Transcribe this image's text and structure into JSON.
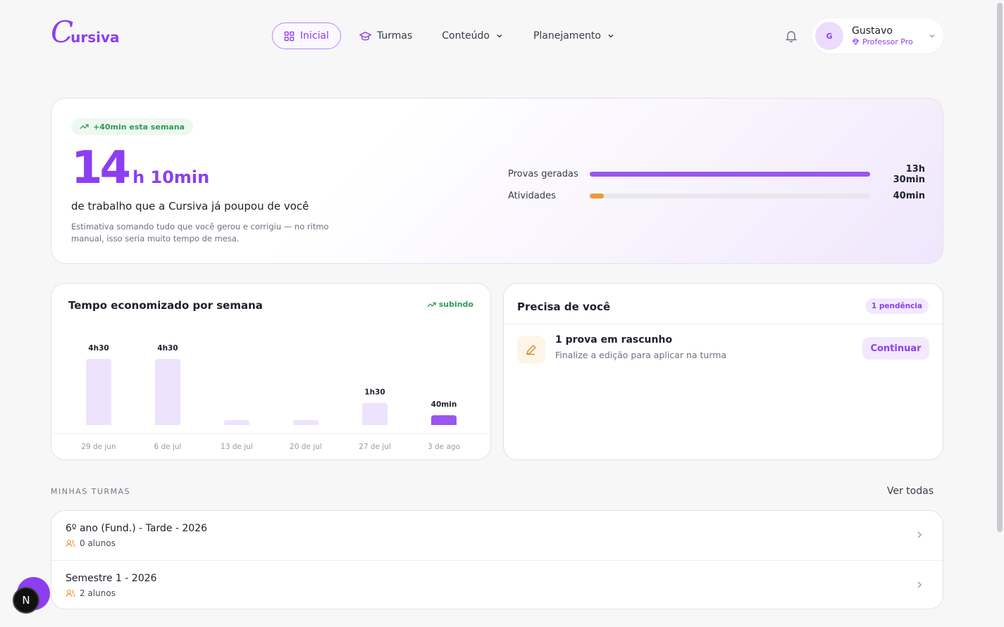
{
  "brand": {
    "logo_initial": "C",
    "logo_rest": "ursiva"
  },
  "nav": [
    {
      "label": "Inicial",
      "icon": "grid-icon",
      "active": true
    },
    {
      "label": "Turmas",
      "icon": "graduation-cap-icon"
    },
    {
      "label": "Conteúdo",
      "icon": "chevron-down-icon"
    },
    {
      "label": "Planejamento",
      "icon": "chevron-down-icon"
    }
  ],
  "user": {
    "initial": "G",
    "name": "Gustavo",
    "role": "Professor Pro"
  },
  "hero": {
    "badge": "+40min esta semana",
    "hours": "14",
    "rest": "h 10min",
    "subtitle": "de trabalho que a Cursiva já poupou de você",
    "description": "Estimativa somando tudo que você gerou e corrigiu — no ritmo manual, isso seria muito tempo de mesa.",
    "breakdown": [
      {
        "label": "Provas geradas",
        "value": "13h 30min",
        "fraction": 1.0,
        "color": "#9b55f0"
      },
      {
        "label": "Atividades",
        "value": "40min",
        "fraction": 0.05,
        "color": "#f0973a"
      }
    ]
  },
  "weekly": {
    "title": "Tempo economizado por semana",
    "trend": "subindo"
  },
  "chart_data": {
    "type": "bar",
    "title": "Tempo economizado por semana",
    "categories": [
      "29 de jun",
      "6 de jul",
      "13 de jul",
      "20 de jul",
      "27 de jul",
      "3 de ago"
    ],
    "values": [
      270,
      270,
      0,
      0,
      90,
      40
    ],
    "value_labels": [
      "4h30",
      "4h30",
      "",
      "",
      "1h30",
      "40min"
    ],
    "unit": "min",
    "highlight_index": 5,
    "colors": {
      "bar": "#eee3fd",
      "highlight": "#9b55f0"
    },
    "ylim": [
      0,
      270
    ],
    "grid": false
  },
  "needs": {
    "title": "Precisa de você",
    "badge": "1 pendência",
    "task_title": "1 prova em rascunho",
    "task_sub": "Finalize a edição para aplicar na turma",
    "button": "Continuar"
  },
  "classes": {
    "section_label": "MINHAS TURMAS",
    "see_all": "Ver todas",
    "items": [
      {
        "name": "6º ano (Fund.) - Tarde - 2026",
        "students": "0 alunos"
      },
      {
        "name": "Semestre 1 - 2026",
        "students": "2 alunos"
      }
    ]
  },
  "floating": {
    "dev_badge": "N"
  }
}
